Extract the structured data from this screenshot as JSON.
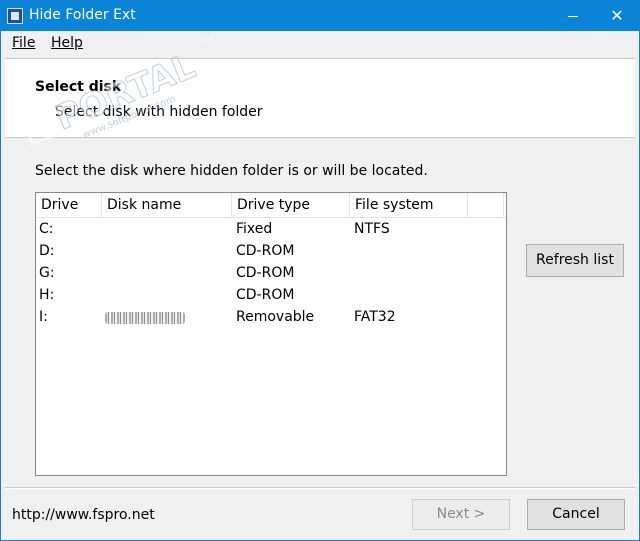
{
  "window": {
    "title": "Hide Folder Ext",
    "minimize_glyph": "",
    "close_glyph": "✕"
  },
  "menu": {
    "file": "File",
    "help": "Help"
  },
  "header": {
    "title": "Select disk",
    "subtitle": "Select disk with hidden folder"
  },
  "instruction": "Select the disk where hidden folder is or will be located.",
  "table": {
    "columns": [
      "Drive",
      "Disk name",
      "Drive type",
      "File system"
    ],
    "rows": [
      {
        "drive": "C:",
        "name": "",
        "type": "Fixed",
        "fs": "NTFS"
      },
      {
        "drive": "D:",
        "name": "",
        "type": "CD-ROM",
        "fs": ""
      },
      {
        "drive": "G:",
        "name": "",
        "type": "CD-ROM",
        "fs": ""
      },
      {
        "drive": "H:",
        "name": "",
        "type": "CD-ROM",
        "fs": ""
      },
      {
        "drive": "I:",
        "name": "",
        "type": "Removable",
        "fs": "FAT32"
      }
    ]
  },
  "buttons": {
    "refresh": "Refresh list",
    "next": "Next >",
    "cancel": "Cancel"
  },
  "footer": {
    "link": "http://www.fspro.net"
  },
  "watermark": {
    "text": "PORTAL",
    "tm": "TM",
    "url": "www.softportal.com"
  },
  "colors": {
    "titlebar": "#0a84d6",
    "accent": "#0078d7"
  }
}
